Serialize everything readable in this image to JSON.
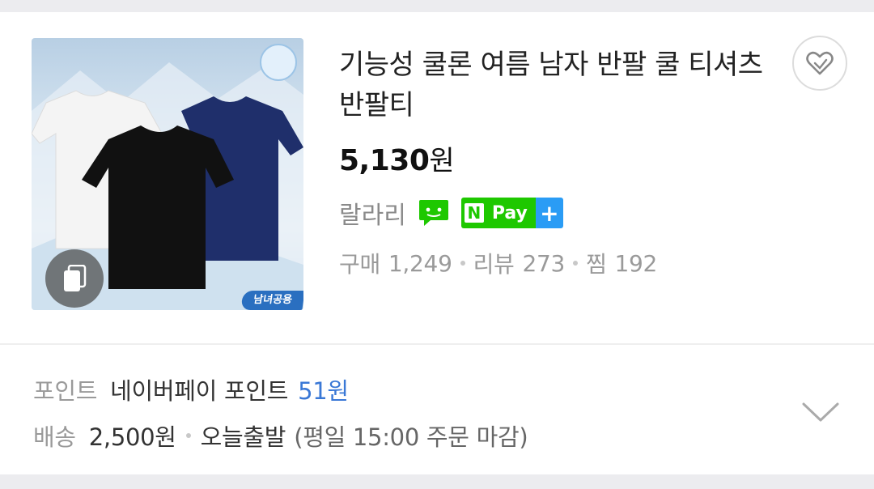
{
  "product": {
    "title": "기능성 쿨론 여름 남자 반팔 쿨 티셔츠 반팔티",
    "price_value": "5,130",
    "price_unit": "원",
    "seller": "랄라리",
    "image_badge": "남녀공용",
    "npay_letter": "N",
    "npay_label": "Pay",
    "npay_plus": "+",
    "stats": {
      "purchase_label": "구매",
      "purchase_count": "1,249",
      "review_label": "리뷰",
      "review_count": "273",
      "wish_label": "찜",
      "wish_count": "192"
    }
  },
  "benefits": {
    "point_label": "포인트",
    "point_desc": "네이버페이 포인트",
    "point_value": "51원",
    "shipping_label": "배송",
    "shipping_fee": "2,500원",
    "shipping_status": "오늘출발",
    "shipping_note": "(평일 15:00 주문 마감)"
  },
  "colors": {
    "npay_green": "#1ec800",
    "npay_blue": "#2a9cf5",
    "point_blue": "#3a78d6"
  },
  "icons": [
    "multi-image-icon",
    "heart-icon",
    "talk-icon",
    "chevron-down-icon"
  ]
}
